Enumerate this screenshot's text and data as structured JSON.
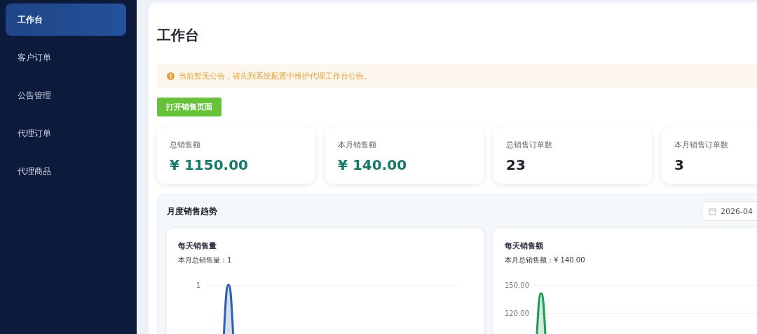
{
  "sidebar": {
    "items": [
      {
        "label": "工作台",
        "selected": true
      },
      {
        "label": "客户订单",
        "selected": false
      },
      {
        "label": "公告管理",
        "selected": false
      },
      {
        "label": "代理订单",
        "selected": false
      },
      {
        "label": "代理商品",
        "selected": false
      }
    ]
  },
  "page": {
    "title": "工作台",
    "notice": "当前暂无公告，请先到系统配置中维护代理工作台公告。",
    "open_button": "打开销售页面"
  },
  "stats": [
    {
      "label": "总销售额",
      "value": "¥ 1150.00",
      "kind": "money"
    },
    {
      "label": "本月销售额",
      "value": "¥ 140.00",
      "kind": "money"
    },
    {
      "label": "总销售订单数",
      "value": "23",
      "kind": "count"
    },
    {
      "label": "本月销售订单数",
      "value": "3",
      "kind": "count"
    }
  ],
  "trend": {
    "title": "月度销售趋势",
    "month": "2026-04",
    "charts": [
      {
        "title": "每天销售量",
        "summary": "本月总销售量：1",
        "axis_labels": [
          "1"
        ],
        "color": "#2f5fb3"
      },
      {
        "title": "每天销售额",
        "summary": "本月总销售额：¥ 140.00",
        "axis_labels": [
          "150.00",
          "120.00"
        ],
        "color": "#1f9d55"
      }
    ]
  }
}
